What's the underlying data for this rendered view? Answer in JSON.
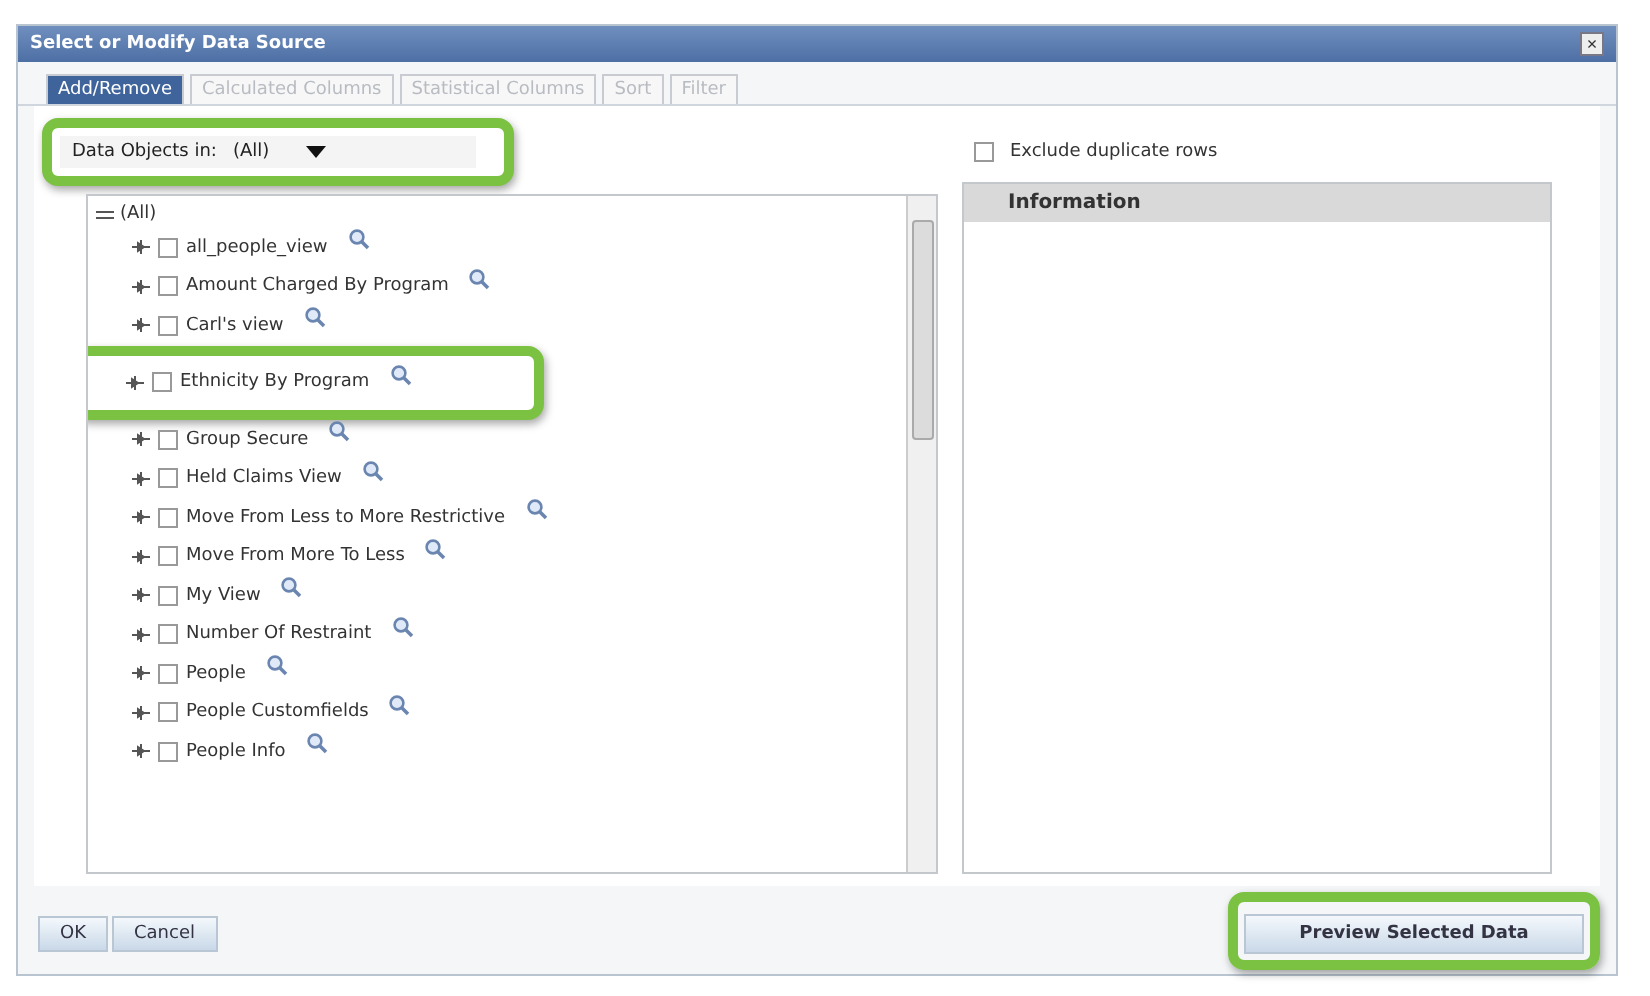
{
  "window": {
    "title": "Select or Modify Data Source",
    "close": "×"
  },
  "tabs": [
    {
      "label": "Add/Remove",
      "selected": true
    },
    {
      "label": "Calculated Columns",
      "selected": false
    },
    {
      "label": "Statistical Columns",
      "selected": false
    },
    {
      "label": "Sort",
      "selected": false
    },
    {
      "label": "Filter",
      "selected": false
    }
  ],
  "data_objects": {
    "label": "Data Objects in:",
    "value": "(All)",
    "highlighted": true
  },
  "tree": {
    "root": "(All)",
    "expanded": true,
    "items": [
      {
        "label": "all_people_view",
        "checked": false,
        "highlighted": false
      },
      {
        "label": "Amount Charged By Program",
        "checked": false,
        "highlighted": false
      },
      {
        "label": "Carl's view",
        "checked": false,
        "highlighted": false
      },
      {
        "label": "Ethnicity By Program",
        "checked": false,
        "highlighted": true
      },
      {
        "label": "Group Secure",
        "checked": false,
        "highlighted": false
      },
      {
        "label": "Held Claims View",
        "checked": false,
        "highlighted": false
      },
      {
        "label": "Move From Less to More Restrictive",
        "checked": false,
        "highlighted": false
      },
      {
        "label": "Move From More To Less",
        "checked": false,
        "highlighted": false
      },
      {
        "label": "My View",
        "checked": false,
        "highlighted": false
      },
      {
        "label": "Number Of Restraint",
        "checked": false,
        "highlighted": false
      },
      {
        "label": "People",
        "checked": false,
        "highlighted": false
      },
      {
        "label": "People Customfields",
        "checked": false,
        "highlighted": false
      },
      {
        "label": "People Info",
        "checked": false,
        "highlighted": false
      }
    ]
  },
  "exclude_duplicates": {
    "label": "Exclude duplicate rows",
    "checked": false
  },
  "information": {
    "title": "Information"
  },
  "buttons": [
    {
      "label": "OK",
      "kind": "plain"
    },
    {
      "label": "Cancel",
      "kind": "plain"
    },
    {
      "label": "Preview Selected Data",
      "kind": "wide",
      "highlighted": true
    }
  ]
}
